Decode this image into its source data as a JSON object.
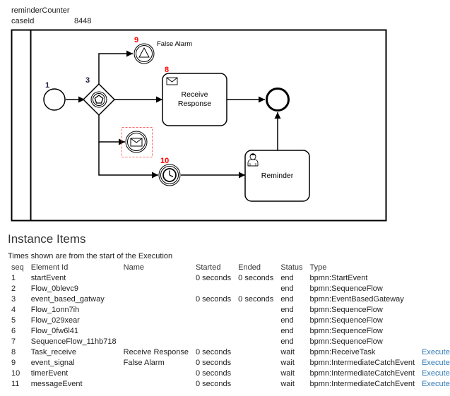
{
  "variables": [
    {
      "key": "reminderCounter",
      "value": ""
    },
    {
      "key": "caseId",
      "value": "8448"
    }
  ],
  "diagram": {
    "colors": {
      "stroke": "#000000",
      "seq_label": "#1a1a40",
      "active_label": "#ff0000",
      "highlight": "#ff6666"
    },
    "elements": {
      "start_event": {
        "seq": "1",
        "label": ""
      },
      "gateway": {
        "seq": "3",
        "label": ""
      },
      "signal_event": {
        "seq": "9",
        "label": "False Alarm"
      },
      "receive_task": {
        "seq": "8",
        "label_line1": "Receive",
        "label_line2": "Response"
      },
      "message_event": {
        "seq": "",
        "label": ""
      },
      "timer_event": {
        "seq": "10",
        "label": ""
      },
      "reminder_task": {
        "seq": "",
        "label": "Reminder"
      },
      "end_event": {
        "seq": "",
        "label": ""
      }
    }
  },
  "instance": {
    "title": "Instance Items",
    "note": "Times shown are from the start of the Execution",
    "columns": [
      "seq",
      "Element Id",
      "Name",
      "Started",
      "Ended",
      "Status",
      "Type",
      ""
    ],
    "rows": [
      {
        "seq": "1",
        "element": "startEvent",
        "name": "",
        "started": "0 seconds",
        "ended": "0 seconds",
        "status": "end",
        "type": "bpmn:StartEvent",
        "action": ""
      },
      {
        "seq": "2",
        "element": "Flow_0blevc9",
        "name": "",
        "started": "",
        "ended": "",
        "status": "end",
        "type": "bpmn:SequenceFlow",
        "action": ""
      },
      {
        "seq": "3",
        "element": "event_based_gatway",
        "name": "",
        "started": "0 seconds",
        "ended": "0 seconds",
        "status": "end",
        "type": "bpmn:EventBasedGateway",
        "action": ""
      },
      {
        "seq": "4",
        "element": "Flow_1onn7ih",
        "name": "",
        "started": "",
        "ended": "",
        "status": "end",
        "type": "bpmn:SequenceFlow",
        "action": ""
      },
      {
        "seq": "5",
        "element": "Flow_029xear",
        "name": "",
        "started": "",
        "ended": "",
        "status": "end",
        "type": "bpmn:SequenceFlow",
        "action": ""
      },
      {
        "seq": "6",
        "element": "Flow_0fw6l41",
        "name": "",
        "started": "",
        "ended": "",
        "status": "end",
        "type": "bpmn:SequenceFlow",
        "action": ""
      },
      {
        "seq": "7",
        "element": "SequenceFlow_11hb718",
        "name": "",
        "started": "",
        "ended": "",
        "status": "end",
        "type": "bpmn:SequenceFlow",
        "action": ""
      },
      {
        "seq": "8",
        "element": "Task_receive",
        "name": "Receive Response",
        "started": "0 seconds",
        "ended": "",
        "status": "wait",
        "type": "bpmn:ReceiveTask",
        "action": "Execute"
      },
      {
        "seq": "9",
        "element": "event_signal",
        "name": "False Alarm",
        "started": "0 seconds",
        "ended": "",
        "status": "wait",
        "type": "bpmn:IntermediateCatchEvent",
        "action": "Execute"
      },
      {
        "seq": "10",
        "element": "timerEvent",
        "name": "",
        "started": "0 seconds",
        "ended": "",
        "status": "wait",
        "type": "bpmn:IntermediateCatchEvent",
        "action": "Execute"
      },
      {
        "seq": "11",
        "element": "messageEvent",
        "name": "",
        "started": "0 seconds",
        "ended": "",
        "status": "wait",
        "type": "bpmn:IntermediateCatchEvent",
        "action": "Execute"
      }
    ]
  }
}
